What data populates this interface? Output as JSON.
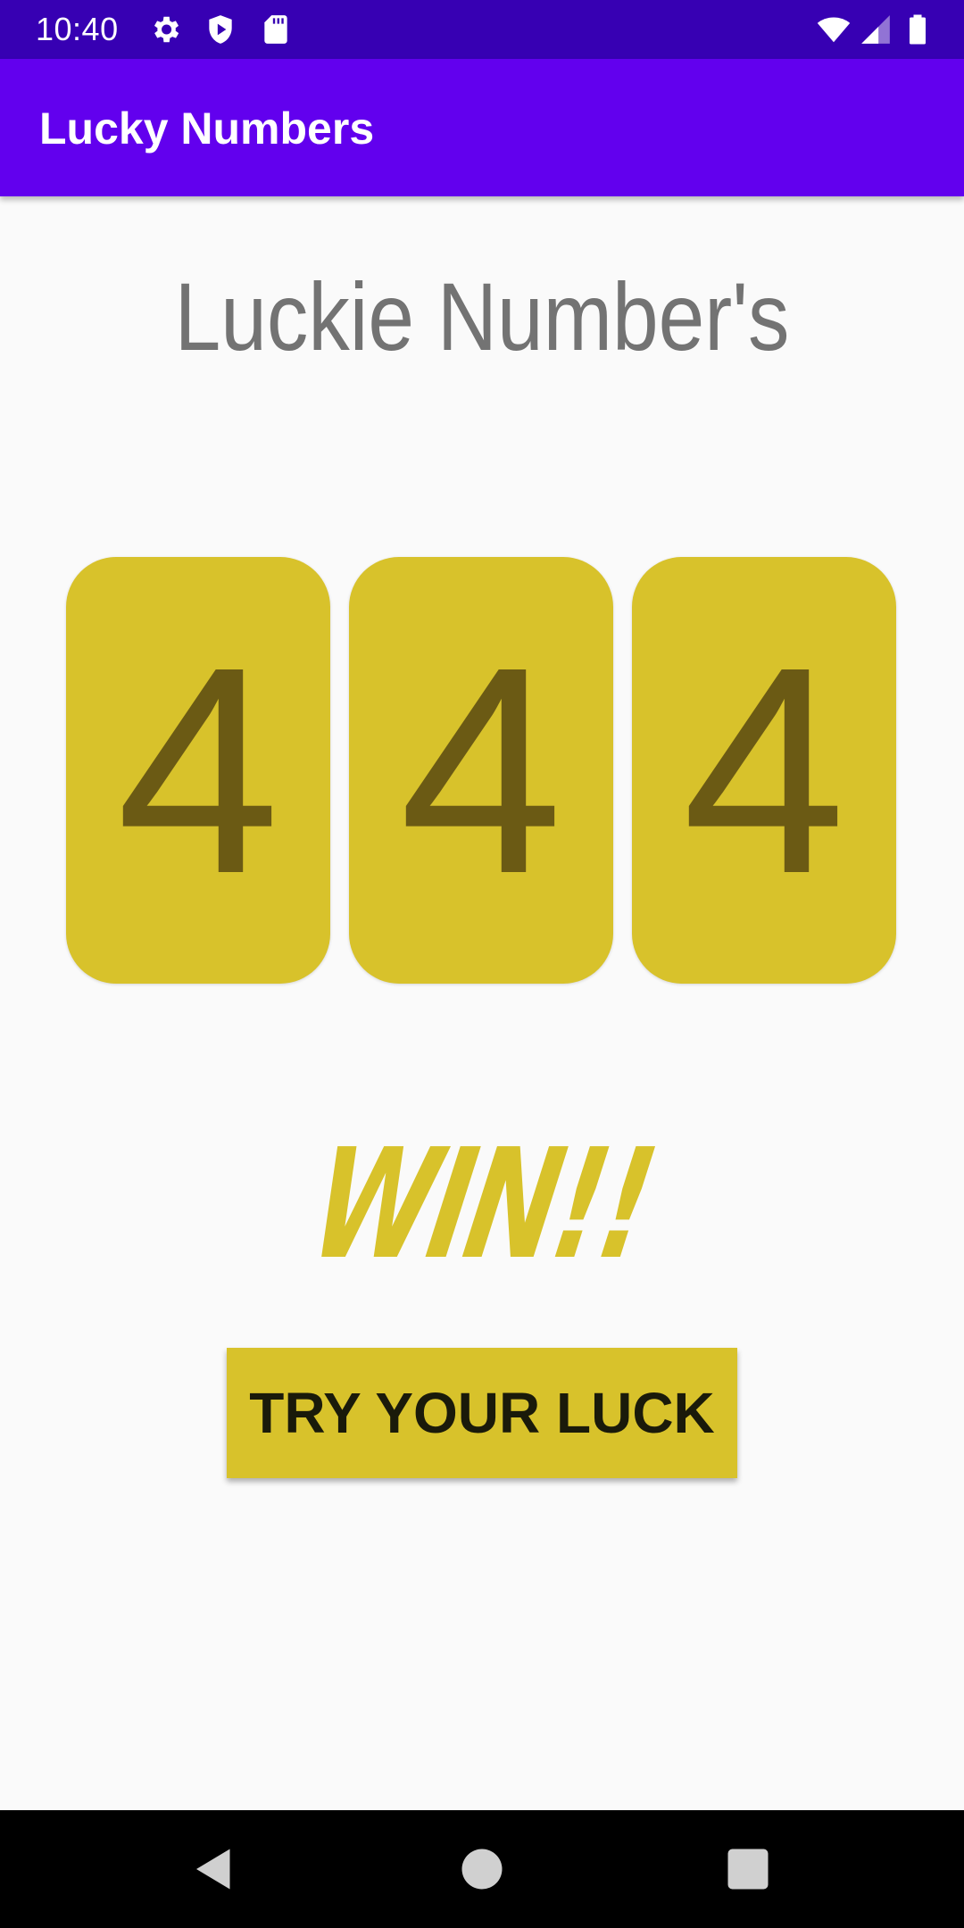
{
  "status_bar": {
    "time": "10:40",
    "icons": [
      "gear-icon",
      "shield-play-icon",
      "sd-card-icon",
      "wifi-icon",
      "signal-icon",
      "battery-icon"
    ]
  },
  "app_bar": {
    "title": "Lucky Numbers"
  },
  "main": {
    "heading": "Luckie Number's",
    "numbers": [
      "4",
      "4",
      "4"
    ],
    "result": "WIN!!",
    "button_label": "TRY YOUR LUCK"
  },
  "nav_bar": {
    "buttons": [
      "back-icon",
      "home-icon",
      "recents-icon"
    ]
  },
  "colors": {
    "status_bar": "#3700b3",
    "app_bar": "#6200ee",
    "accent": "#d8c22b",
    "number_text": "#6b5a14",
    "heading_text": "#737373"
  }
}
